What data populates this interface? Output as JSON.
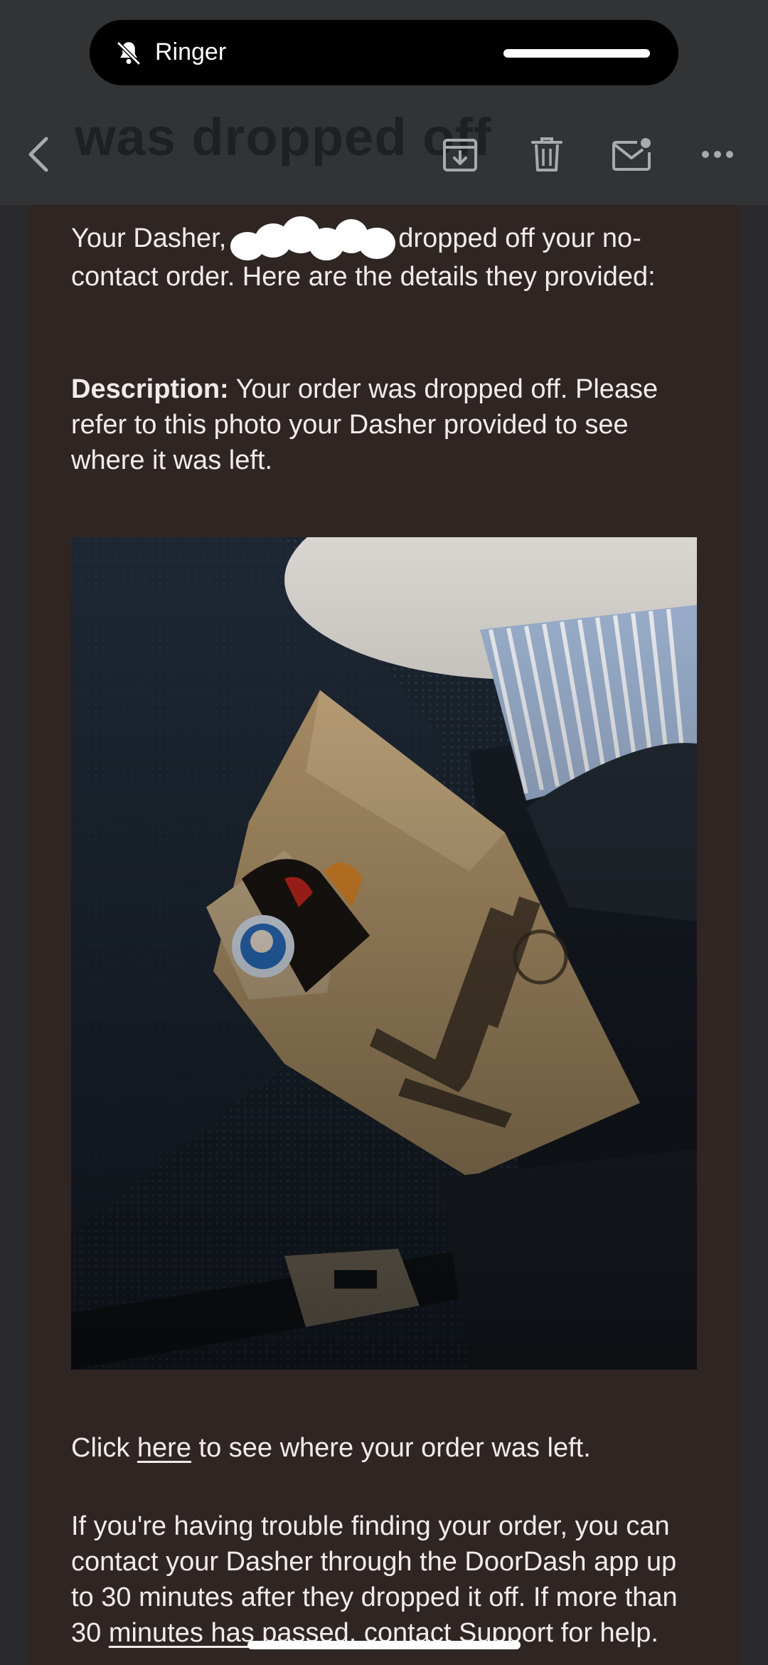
{
  "status_pill": {
    "label": "Ringer",
    "icon": "bell-slash-icon"
  },
  "header": {
    "ghost_title": "was dropped off"
  },
  "toolbar": {
    "back_icon": "chevron-left-icon",
    "archive_icon": "archive-icon",
    "delete_icon": "trash-icon",
    "mark_unread_icon": "envelope-dot-icon",
    "more_icon": "more-icon"
  },
  "email": {
    "intro_before": "Your Dasher,",
    "intro_after": "dropped off your no-contact order. Here are the details they provided:",
    "description_label": "Description:",
    "description_text": " Your order was dropped off. Please refer to this photo your Dasher provided to see where it was left.",
    "photo_alt": "Dasher drop-off photo: a Mary Brown's paper bag on a car seat",
    "click_before": "Click ",
    "click_link": "here",
    "click_after": " to see where your order was left.",
    "trouble_text_1": "If you're having trouble finding your order, you can contact your Dasher through the DoorDash app up to 30 minutes after they dropped it off. If more than 30 ",
    "trouble_link": "minutes has passed,",
    "trouble_text_2": " contact Support for help."
  },
  "colors": {
    "topbar": "#323335",
    "email_bg": "#2f2624",
    "text": "#f1ecea"
  }
}
